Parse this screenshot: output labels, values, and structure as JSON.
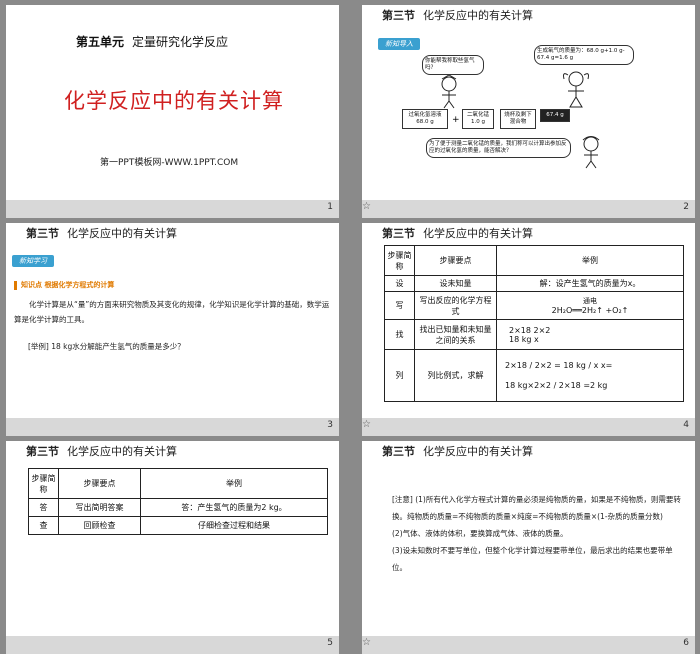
{
  "slide1": {
    "unit_label": "第五单元",
    "unit_title": "定量研究化学反应",
    "main_title": "化学反应中的有关计算",
    "site": "第一PPT模板网-WWW.1PPT.COM",
    "page": "1"
  },
  "slide2": {
    "section": "第三节",
    "section_title": "化学反应中的有关计算",
    "badge": "新知导入",
    "bubble1": "你能帮我称取些氢气吗？",
    "bubble2": "生成氧气的质量为：68.0 g+1.0 g-67.4 g=1.6 g",
    "box1": "过氧化氢溶液 68.0 g",
    "plus": "+",
    "box2": "二氧化锰 1.0 g",
    "box3": "烧杯及剩下 混合物",
    "box4": "67.4 g",
    "bubble3": "为了便于测量二氧化锰的质量，我们称可以计算出参加反应的过氧化氢的质量，能否解决？",
    "page": "2"
  },
  "slide3": {
    "section": "第三节",
    "section_title": "化学反应中的有关计算",
    "badge": "新知学习",
    "kp_label": "知识点",
    "kp_title": "根据化学方程式的计算",
    "para": "化学计算是从“量”的方面来研究物质及其变化的规律，化学知识是化学计算的基础，数学运算是化学计算的工具。",
    "example": "[举例] 18 kg水分解能产生氢气的质量是多少？",
    "page": "3"
  },
  "slide4": {
    "section": "第三节",
    "section_title": "化学反应中的有关计算",
    "headers": [
      "步骤简称",
      "步骤要点",
      "举例"
    ],
    "rows": [
      {
        "short": "设",
        "point": "设未知量",
        "example": "解：设产生氢气的质量为x。"
      },
      {
        "short": "写",
        "point": "写出反应的化学方程式",
        "example_top": "通电",
        "example": "2H₂O══2H₂↑ +O₂↑"
      },
      {
        "short": "找",
        "point": "找出已知量和未知量之间的关系",
        "example_a": "2×18      2×2",
        "example_b": "18 kg          x"
      },
      {
        "short": "列",
        "point": "列比例式，求解",
        "example_a": "2×18 / 2×2 = 18 kg / x    x=",
        "example_b": "18 kg×2×2 / 2×18 =2 kg"
      }
    ],
    "page": "4"
  },
  "slide5": {
    "section": "第三节",
    "section_title": "化学反应中的有关计算",
    "headers": [
      "步骤简称",
      "步骤要点",
      "举例"
    ],
    "rows": [
      {
        "short": "答",
        "point": "写出简明答案",
        "example": "答：产生氢气的质量为2 kg。"
      },
      {
        "short": "查",
        "point": "回顾检查",
        "example": "仔细检查过程和结果"
      }
    ],
    "page": "5"
  },
  "slide6": {
    "section": "第三节",
    "section_title": "化学反应中的有关计算",
    "notes": [
      "[注意] (1)所有代入化学方程式计算的量必须是纯物质的量，如果是不纯物质，则需要转换。纯物质的质量=不纯物质的质量×纯度=不纯物质的质量×(1-杂质的质量分数)",
      "(2)气体、液体的体积，要换算成气体、液体的质量。",
      "(3)设未知数时不要写单位，但整个化学计算过程要带单位，最后求出的结果也要带单位。"
    ],
    "page": "6"
  }
}
